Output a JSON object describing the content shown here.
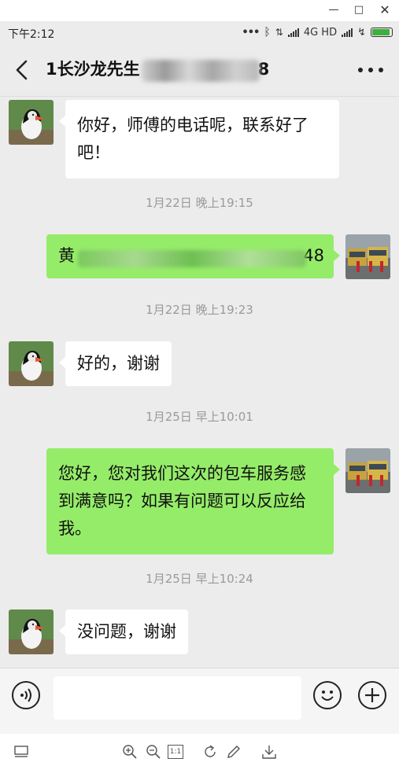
{
  "status_bar": {
    "time": "下午2:12",
    "network_label": "4G HD",
    "icons": [
      "more-dots-icon",
      "bluetooth-icon",
      "data-arrows-icon",
      "signal-icon",
      "signal-icon-2",
      "charging-icon",
      "battery-icon"
    ],
    "battery_color": "#3db03d"
  },
  "header": {
    "title_start": "1长沙龙先生",
    "title_end": "8"
  },
  "messages": [
    {
      "side": "in",
      "text": "你好，师傅的电话呢，联系好了吧！"
    },
    {
      "side": "ts",
      "text": "1月22日 晚上19:15"
    },
    {
      "side": "out",
      "text_start": "黄",
      "text_end": "48"
    },
    {
      "side": "ts",
      "text": "1月22日 晚上19:23"
    },
    {
      "side": "in",
      "text": "好的，谢谢"
    },
    {
      "side": "ts",
      "text": "1月25日 早上10:01"
    },
    {
      "side": "out",
      "text": "您好，您对我们这次的包车服务感到满意吗？如果有问题可以反应给我。"
    },
    {
      "side": "ts",
      "text": "1月25日 早上10:24"
    },
    {
      "side": "in",
      "text": "没问题，谢谢"
    }
  ],
  "input_bar": {
    "value": "",
    "icons": [
      "voice-icon",
      "emoji-icon",
      "plus-icon"
    ]
  },
  "viewer_toolbar": {
    "icons": [
      "thumbnail-icon",
      "zoom-in-icon",
      "zoom-out-icon",
      "actual-size-icon",
      "rotate-icon",
      "edit-icon",
      "download-icon"
    ],
    "actual_size_label": "1:1"
  },
  "colors": {
    "outgoing_bubble": "#95ec69",
    "incoming_bubble": "#ffffff",
    "chat_background": "#ececec"
  }
}
